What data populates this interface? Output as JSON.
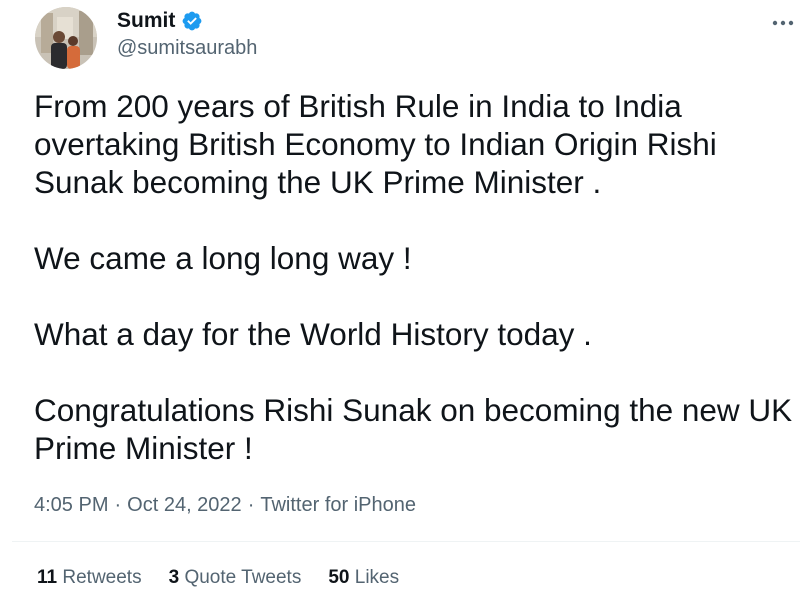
{
  "user": {
    "display_name": "Sumit",
    "handle": "@sumitsaurabh",
    "verified": true,
    "avatar_icon": "profile-photo",
    "verified_icon": "verified-badge-icon",
    "verified_color": "#1d9bf0"
  },
  "menu": {
    "more_icon": "more-horizontal-icon"
  },
  "tweet": {
    "paragraphs": [
      "From 200 years of British Rule in India to India overtaking British Economy to Indian Origin Rishi Sunak becoming the UK Prime Minister .",
      "We came a long long way !",
      "What a day for the World History today .",
      "Congratulations Rishi Sunak on becoming the new UK Prime Minister !"
    ]
  },
  "meta": {
    "time": "4:05 PM",
    "separator": "·",
    "date": "Oct 24, 2022",
    "source": "Twitter for iPhone"
  },
  "stats": {
    "retweets_count": "11",
    "retweets_label": "Retweets",
    "quote_tweets_count": "3",
    "quote_tweets_label": "Quote Tweets",
    "likes_count": "50",
    "likes_label": "Likes"
  },
  "colors": {
    "text": "#0f1419",
    "secondary": "#536471",
    "divider": "#eff3f4"
  }
}
